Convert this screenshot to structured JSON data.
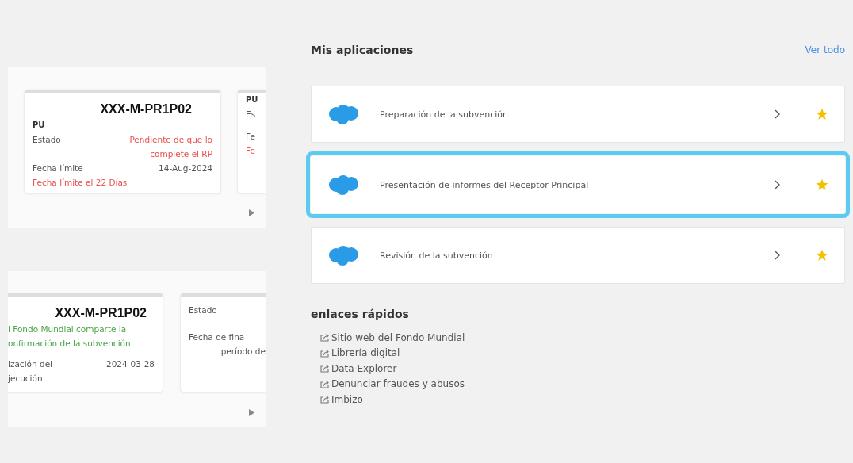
{
  "panels": [
    {
      "cards": [
        {
          "title": "XXX-M-PR1P02",
          "lines": [
            {
              "kind": "type",
              "left": "PU"
            },
            {
              "kind": "status_row",
              "left": "Estado",
              "right": "Pendiente de que lo complete el RP"
            },
            {
              "kind": "row",
              "left": "Fecha límite",
              "right": "14-Aug-2024"
            },
            {
              "kind": "warning",
              "left": "Fecha límite el 22 Días"
            }
          ]
        },
        {
          "lines": [
            {
              "kind": "type",
              "left": "PU"
            },
            {
              "kind": "row",
              "left": "Es"
            },
            {
              "kind": "spacer"
            },
            {
              "kind": "row",
              "left": "Fe"
            },
            {
              "kind": "warning",
              "left": "Fe"
            }
          ]
        }
      ]
    },
    {
      "cards": [
        {
          "title": "XXX-M-PR1P02",
          "cut_left": true,
          "lines": [
            {
              "kind": "info",
              "left": "l Fondo Mundial comparte la"
            },
            {
              "kind": "info",
              "left": "onfirmación de la subvención"
            },
            {
              "kind": "spacer"
            },
            {
              "kind": "row",
              "left": "ización del",
              "right": "2024-03-28"
            },
            {
              "kind": "row",
              "left": "jecución"
            }
          ]
        },
        {
          "lines": [
            {
              "kind": "spacer"
            },
            {
              "kind": "row",
              "left": "Estado"
            },
            {
              "kind": "spacer"
            },
            {
              "kind": "spacer"
            },
            {
              "kind": "row",
              "left": "Fecha de fina"
            },
            {
              "kind": "row",
              "right": "período de"
            }
          ]
        }
      ]
    }
  ],
  "apps": {
    "title": "Mis aplicaciones",
    "link": "Ver todo",
    "items": [
      {
        "label": "Preparación de la subvención",
        "selected": false,
        "favorite": true
      },
      {
        "label": "Presentación de informes del Receptor Principal",
        "selected": true,
        "favorite": true
      },
      {
        "label": "Revisión de la subvención",
        "selected": false,
        "favorite": true
      }
    ]
  },
  "quick_links": {
    "title": "enlaces rápidos",
    "items": [
      "Sitio web del Fondo Mundial",
      "Librería digital",
      "Data Explorer",
      "Denunciar fraudes y abusos",
      "Imbizo"
    ]
  }
}
